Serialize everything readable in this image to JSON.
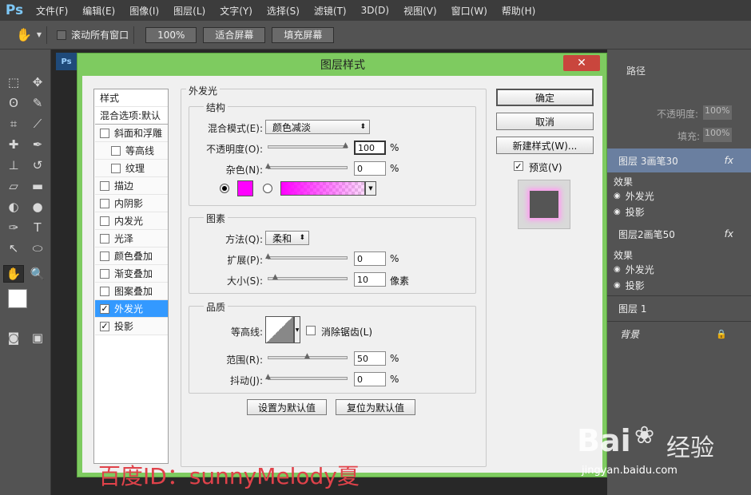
{
  "app": {
    "logo": "Ps"
  },
  "menu": [
    "文件(F)",
    "编辑(E)",
    "图像(I)",
    "图层(L)",
    "文字(Y)",
    "选择(S)",
    "滤镜(T)",
    "3D(D)",
    "视图(V)",
    "窗口(W)",
    "帮助(H)"
  ],
  "options": {
    "scroll_all_label": "滚动所有窗口",
    "zoom_btn": "100%",
    "fit_btn": "适合屏幕",
    "fill_btn": "填充屏幕"
  },
  "dialog": {
    "title": "图层样式",
    "close": "✕"
  },
  "styles": {
    "header": "样式",
    "blend": "混合选项:默认",
    "items": [
      {
        "label": "斜面和浮雕",
        "checked": false,
        "indent": false
      },
      {
        "label": "等高线",
        "checked": false,
        "indent": true
      },
      {
        "label": "纹理",
        "checked": false,
        "indent": true
      },
      {
        "label": "描边",
        "checked": false,
        "indent": false
      },
      {
        "label": "内阴影",
        "checked": false,
        "indent": false
      },
      {
        "label": "内发光",
        "checked": false,
        "indent": false
      },
      {
        "label": "光泽",
        "checked": false,
        "indent": false
      },
      {
        "label": "颜色叠加",
        "checked": false,
        "indent": false
      },
      {
        "label": "渐变叠加",
        "checked": false,
        "indent": false
      },
      {
        "label": "图案叠加",
        "checked": false,
        "indent": false
      },
      {
        "label": "外发光",
        "checked": true,
        "indent": false,
        "selected": true
      },
      {
        "label": "投影",
        "checked": true,
        "indent": false
      }
    ]
  },
  "outer_glow": {
    "title": "外发光",
    "structure": {
      "title": "结构",
      "blend_mode_label": "混合模式(E):",
      "blend_mode": "颜色减淡",
      "opacity_label": "不透明度(O):",
      "opacity": "100",
      "noise_label": "杂色(N):",
      "noise": "0",
      "unit": "%",
      "color": "#ff00ff"
    },
    "elements": {
      "title": "图素",
      "method_label": "方法(Q):",
      "method": "柔和",
      "spread_label": "扩展(P):",
      "spread": "0",
      "size_label": "大小(S):",
      "size": "10",
      "size_unit": "像素"
    },
    "quality": {
      "title": "品质",
      "contour_label": "等高线:",
      "antialias_label": "消除锯齿(L)",
      "range_label": "范围(R):",
      "range": "50",
      "jitter_label": "抖动(J):",
      "jitter": "0"
    },
    "set_default": "设置为默认值",
    "reset_default": "复位为默认值"
  },
  "buttons": {
    "ok": "确定",
    "cancel": "取消",
    "new_style": "新建样式(W)...",
    "preview": "预览(V)"
  },
  "layers_panel": {
    "tab": "路径",
    "opacity_label": "不透明度:",
    "opacity": "100%",
    "fill_label": "填充:",
    "fill": "100%",
    "layers": [
      {
        "name": "图层 3画笔30",
        "fx": "fx"
      },
      {
        "effects": "效果"
      },
      {
        "effect": "外发光"
      },
      {
        "effect": "投影"
      },
      {
        "name": "图层2画笔50",
        "fx": "fx"
      },
      {
        "effects": "效果"
      },
      {
        "effect": "外发光"
      },
      {
        "effect": "投影"
      },
      {
        "name": "图层 1"
      },
      {
        "name": "背景"
      }
    ]
  },
  "watermark": "百度ID：sunnyMelody夏",
  "baidu": {
    "brand": "Bai",
    "brand2": "经验",
    "url": "jingyan.baidu.com"
  }
}
